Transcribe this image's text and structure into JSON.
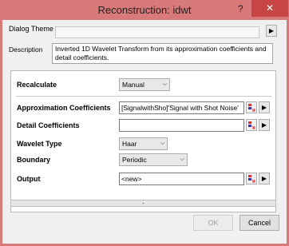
{
  "window": {
    "title": "Reconstruction: idwt",
    "help_label": "?",
    "close_label": "✕"
  },
  "theme": {
    "label": "Dialog Theme",
    "value": "",
    "arrow": "▶"
  },
  "description": {
    "label": "Description",
    "text": "Inverted 1D Wavelet Transform from its approximation coefficients and detail coefficients."
  },
  "form": {
    "recalculate": {
      "label": "Recalculate",
      "value": "Manual"
    },
    "approx": {
      "label": "Approximation Coefficients",
      "value": "[SignalwithSho]'Signal with Shot Noise'"
    },
    "detail": {
      "label": "Detail Coefficients",
      "value": ""
    },
    "wavelet": {
      "label": "Wavelet Type",
      "value": "Haar"
    },
    "boundary": {
      "label": "Boundary",
      "value": "Periodic"
    },
    "output": {
      "label": "Output",
      "value": "<new>"
    }
  },
  "icons": {
    "dropdown_arrow": "chevron-down-icon",
    "pick_icon": "range-picker-icon",
    "menu_arrow": "▶"
  },
  "progress": {
    "dot": "."
  },
  "buttons": {
    "ok": "OK",
    "cancel": "Cancel"
  },
  "colors": {
    "titlebar": "#d97a7a",
    "close": "#c74545"
  }
}
